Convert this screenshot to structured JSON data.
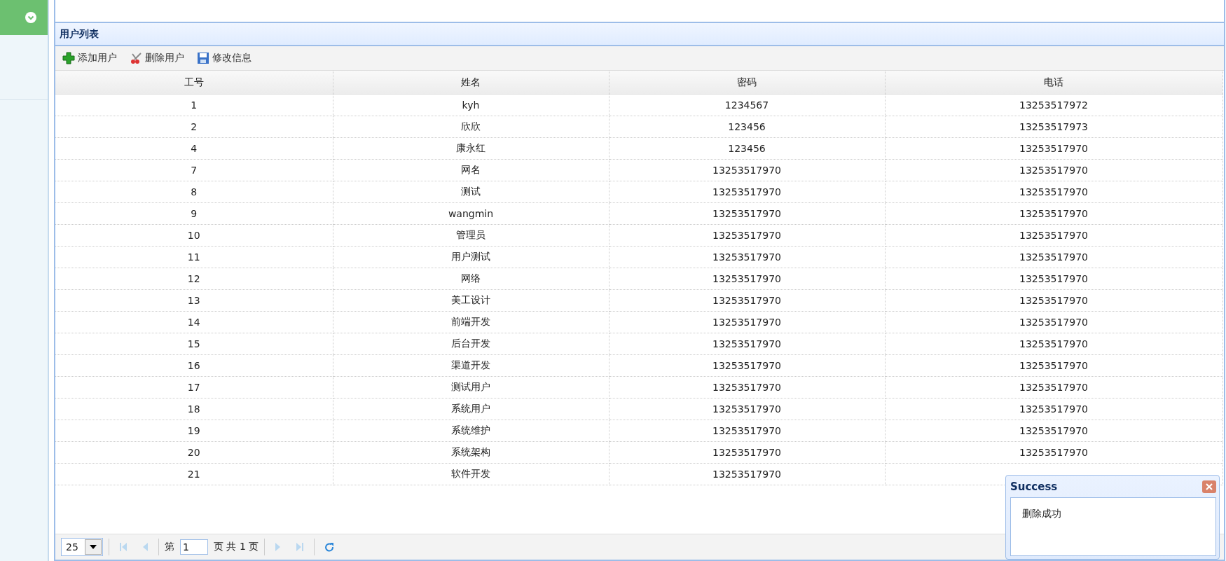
{
  "panel": {
    "title": "用户列表"
  },
  "toolbar": [
    {
      "kind": "add",
      "label": "添加用户"
    },
    {
      "kind": "delete",
      "label": "删除用户"
    },
    {
      "kind": "save",
      "label": "修改信息"
    }
  ],
  "table": {
    "columns": [
      "工号",
      "姓名",
      "密码",
      "电话"
    ],
    "rows": [
      [
        "1",
        "kyh",
        "1234567",
        "13253517972"
      ],
      [
        "2",
        "欣欣",
        "123456",
        "13253517973"
      ],
      [
        "4",
        "康永红",
        "123456",
        "13253517970"
      ],
      [
        "7",
        "网名",
        "13253517970",
        "13253517970"
      ],
      [
        "8",
        "测试",
        "13253517970",
        "13253517970"
      ],
      [
        "9",
        "wangmin",
        "13253517970",
        "13253517970"
      ],
      [
        "10",
        "管理员",
        "13253517970",
        "13253517970"
      ],
      [
        "11",
        "用户测试",
        "13253517970",
        "13253517970"
      ],
      [
        "12",
        "网络",
        "13253517970",
        "13253517970"
      ],
      [
        "13",
        "美工设计",
        "13253517970",
        "13253517970"
      ],
      [
        "14",
        "前端开发",
        "13253517970",
        "13253517970"
      ],
      [
        "15",
        "后台开发",
        "13253517970",
        "13253517970"
      ],
      [
        "16",
        "渠道开发",
        "13253517970",
        "13253517970"
      ],
      [
        "17",
        "测试用户",
        "13253517970",
        "13253517970"
      ],
      [
        "18",
        "系统用户",
        "13253517970",
        "13253517970"
      ],
      [
        "19",
        "系统维护",
        "13253517970",
        "13253517970"
      ],
      [
        "20",
        "系统架构",
        "13253517970",
        "13253517970"
      ],
      [
        "21",
        "软件开发",
        "13253517970"
      ]
    ]
  },
  "pager": {
    "page_size": "25",
    "page_prefix": "第",
    "page": "1",
    "page_suffix": "页 共 1 页",
    "buttons": [
      {
        "kind": "first",
        "disabled": true
      },
      {
        "kind": "prev",
        "disabled": true
      },
      {
        "kind": "next",
        "disabled": true
      },
      {
        "kind": "last",
        "disabled": true
      },
      {
        "kind": "refresh",
        "disabled": false
      }
    ]
  },
  "popup": {
    "title": "Success",
    "message": "删除成功"
  }
}
